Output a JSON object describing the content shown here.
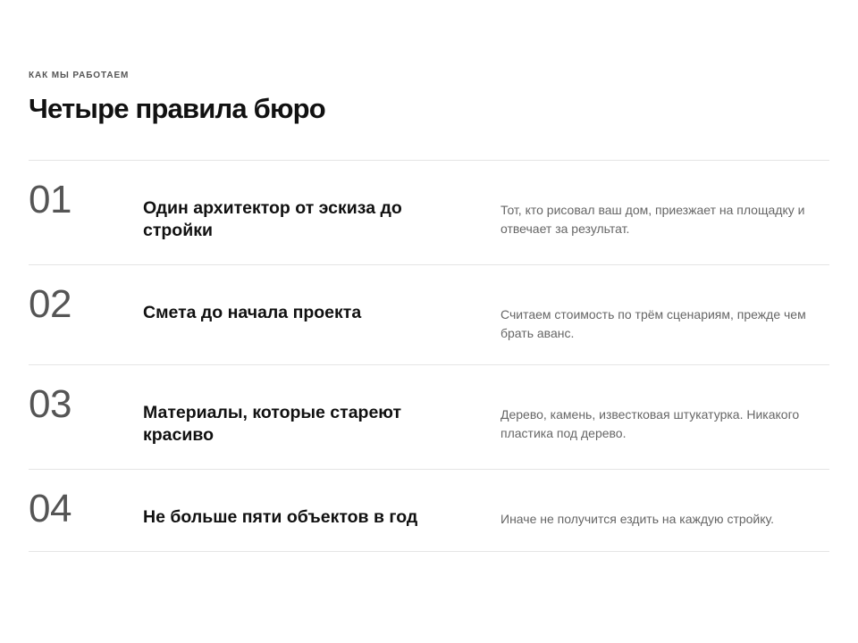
{
  "section": {
    "eyebrow": "КАК МЫ РАБОТАЕМ",
    "title": "Четыре правила бюро"
  },
  "rules": [
    {
      "number": "01",
      "title": "Один архитектор от эскиза до стройки",
      "description": "Тот, кто рисовал ваш дом, приезжает на площадку и отвечает за результат."
    },
    {
      "number": "02",
      "title": "Смета до начала проекта",
      "description": "Считаем стоимость по трём сценариям, прежде чем брать аванс."
    },
    {
      "number": "03",
      "title": "Материалы, которые стареют красиво",
      "description": "Дерево, камень, известковая штукатурка. Никакого пластика под дерево."
    },
    {
      "number": "04",
      "title": "Не больше пяти объектов в год",
      "description": "Иначе не получится ездить на каждую стройку."
    }
  ],
  "colors": {
    "text_primary": "#111111",
    "text_muted": "#666666",
    "number": "#555555",
    "divider": "#e5e5e5",
    "background": "#ffffff"
  }
}
